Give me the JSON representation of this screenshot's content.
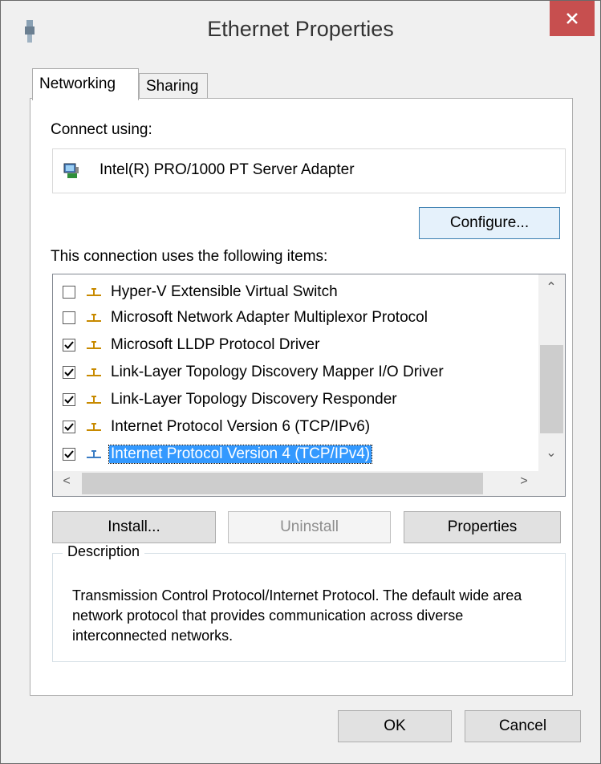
{
  "window": {
    "title": "Ethernet Properties"
  },
  "tabs": [
    {
      "label": "Networking",
      "active": true
    },
    {
      "label": "Sharing",
      "active": false
    }
  ],
  "connect_using": {
    "label": "Connect using:",
    "adapter": "Intel(R) PRO/1000 PT Server Adapter",
    "adapter_icon": "network-adapter-icon"
  },
  "buttons": {
    "configure": "Configure...",
    "install": "Install...",
    "uninstall": "Uninstall",
    "properties": "Properties",
    "ok": "OK",
    "cancel": "Cancel"
  },
  "items_label": "This connection uses the following items:",
  "items": [
    {
      "label": "Hyper-V Extensible Virtual Switch",
      "checked": false,
      "selected": false
    },
    {
      "label": "Microsoft Network Adapter Multiplexor Protocol",
      "checked": false,
      "selected": false
    },
    {
      "label": "Microsoft LLDP Protocol Driver",
      "checked": true,
      "selected": false
    },
    {
      "label": "Link-Layer Topology Discovery Mapper I/O Driver",
      "checked": true,
      "selected": false
    },
    {
      "label": "Link-Layer Topology Discovery Responder",
      "checked": true,
      "selected": false
    },
    {
      "label": "Internet Protocol Version 6 (TCP/IPv6)",
      "checked": true,
      "selected": false
    },
    {
      "label": "Internet Protocol Version 4 (TCP/IPv4)",
      "checked": true,
      "selected": true
    }
  ],
  "description": {
    "legend": "Description",
    "text": "Transmission Control Protocol/Internet Protocol. The default wide area network protocol that provides communication across diverse interconnected networks."
  },
  "colors": {
    "close_button": "#c74f4f",
    "selection": "#3399ff"
  }
}
